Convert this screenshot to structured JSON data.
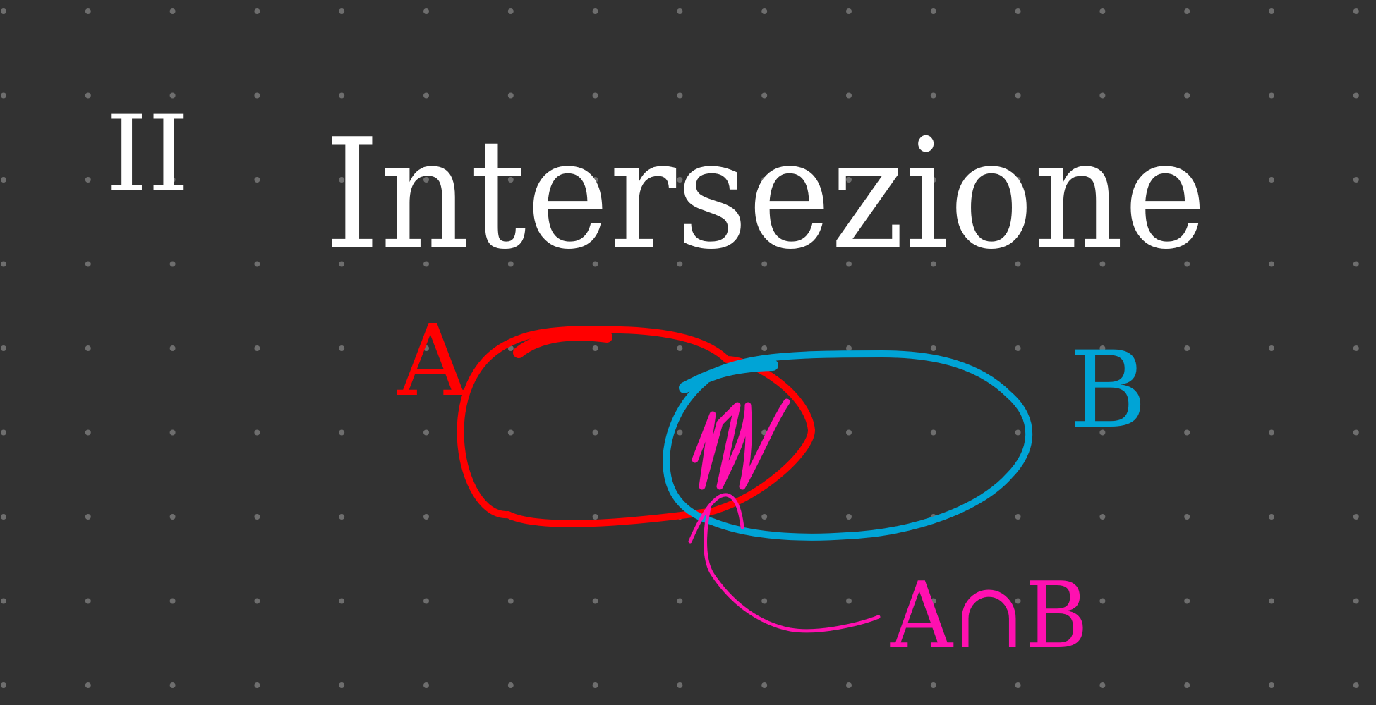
{
  "canvas": {
    "background": "#323232",
    "dot_color": "#6e6e6e"
  },
  "title": {
    "numeral": "II",
    "word": "Intersezione",
    "color": "#ffffff"
  },
  "sets": {
    "a": {
      "label": "A",
      "color": "#ff0000"
    },
    "b": {
      "label": "B",
      "color": "#00a4d6"
    }
  },
  "intersection": {
    "label": "A∩B",
    "color": "#ff10b0"
  }
}
